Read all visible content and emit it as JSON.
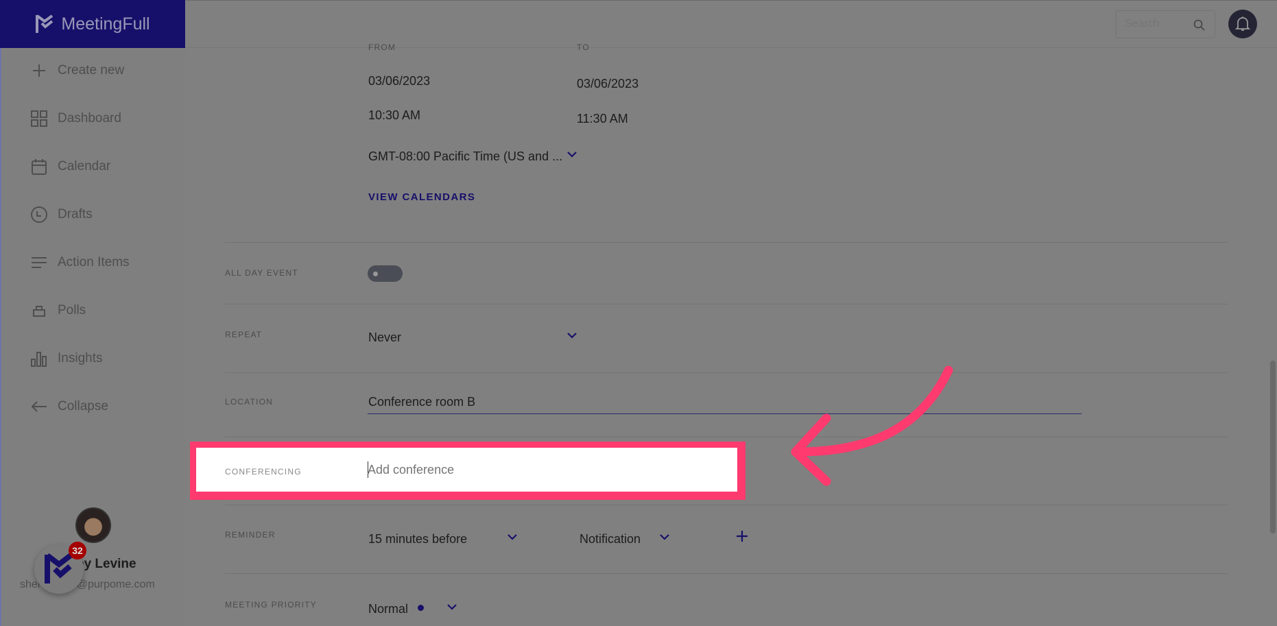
{
  "app": {
    "title": "MeetingFull"
  },
  "header": {
    "search_placeholder": "Search",
    "icons": [
      "search-icon",
      "bell-icon"
    ]
  },
  "sidebar": {
    "items": [
      {
        "label": "Create new",
        "icon": "plus-icon"
      },
      {
        "label": "Dashboard",
        "icon": "grid-icon"
      },
      {
        "label": "Calendar",
        "icon": "calendar-icon"
      },
      {
        "label": "Drafts",
        "icon": "clock-icon"
      },
      {
        "label": "Action Items",
        "icon": "list-icon"
      },
      {
        "label": "Polls",
        "icon": "poll-icon"
      },
      {
        "label": "Insights",
        "icon": "chart-icon"
      },
      {
        "label": "Collapse",
        "icon": "arrow-left-icon"
      }
    ],
    "user": {
      "name": "ey Levine",
      "email": "shel        ne@purpome.com"
    },
    "badge_count": "32"
  },
  "form": {
    "from_label": "FROM",
    "to_label": "TO",
    "from_date": "03/06/2023",
    "to_date": "03/06/2023",
    "from_time": "10:30 AM",
    "to_time": "11:30 AM",
    "timezone": "GMT-08:00 Pacific Time (US and ...",
    "view_calendars": "VIEW CALENDARS",
    "all_day_label": "ALL DAY EVENT",
    "all_day_on": false,
    "repeat_label": "REPEAT",
    "repeat_value": "Never",
    "location_label": "LOCATION",
    "location_value": "Conference room B",
    "conferencing_label": "CONFERENCING",
    "conferencing_placeholder": "Add conference",
    "reminder_label": "REMINDER",
    "reminder_time": "15 minutes before",
    "reminder_type": "Notification",
    "priority_label": "MEETING PRIORITY",
    "priority_value": "Normal"
  },
  "colors": {
    "brand": "#17106a",
    "highlight": "#ff3a6e",
    "overlay": "#808080"
  }
}
